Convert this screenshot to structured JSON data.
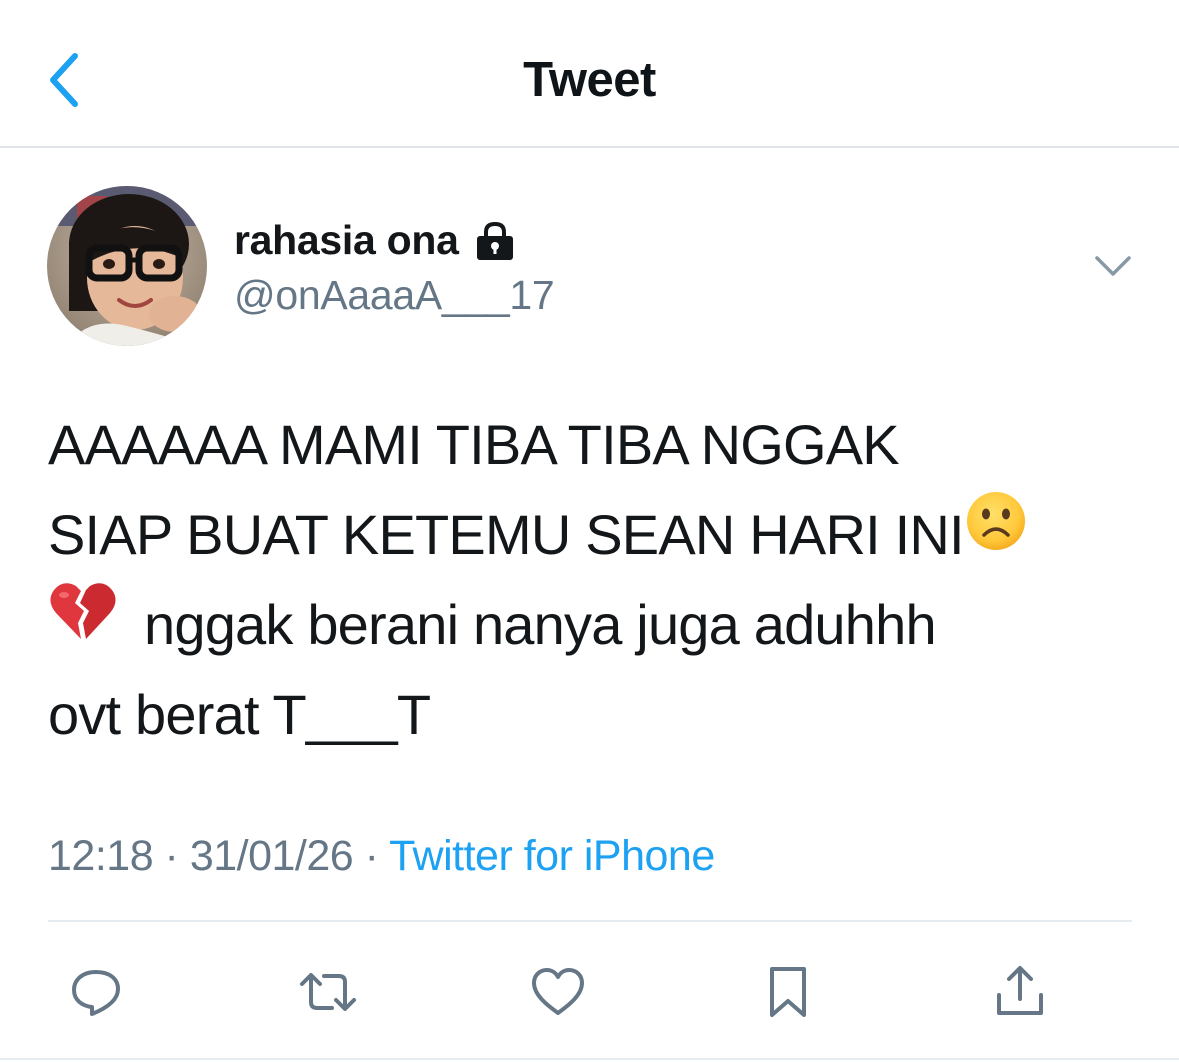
{
  "header": {
    "title": "Tweet",
    "back_icon": "chevron-left-icon",
    "accent_color": "#1da1f2"
  },
  "author": {
    "display_name": "rahasia ona",
    "handle": "@onAaaaA___17",
    "protected_icon": "lock-icon",
    "avatar": "profile-photo"
  },
  "tweet": {
    "lines": [
      "AAAAAA MAMI TIBA TIBA NGGAK",
      "SIAP BUAT KETEMU SEAN HARI INI",
      "nggak berani nanya juga aduhhh",
      "ovt berat T___T"
    ],
    "emojis": [
      "frowning-face-emoji",
      "broken-heart-emoji"
    ]
  },
  "meta": {
    "time": "12:18",
    "separator": " · ",
    "date": "31/01/26",
    "source": "Twitter for iPhone"
  },
  "actions": [
    {
      "name": "reply",
      "icon": "reply-icon"
    },
    {
      "name": "retweet",
      "icon": "retweet-icon"
    },
    {
      "name": "like",
      "icon": "heart-icon"
    },
    {
      "name": "bookmark",
      "icon": "bookmark-icon"
    },
    {
      "name": "share",
      "icon": "share-icon"
    }
  ],
  "colors": {
    "text": "#14171a",
    "secondary_text": "#657786",
    "link": "#1da1f2",
    "divider": "#e6ecf0"
  }
}
